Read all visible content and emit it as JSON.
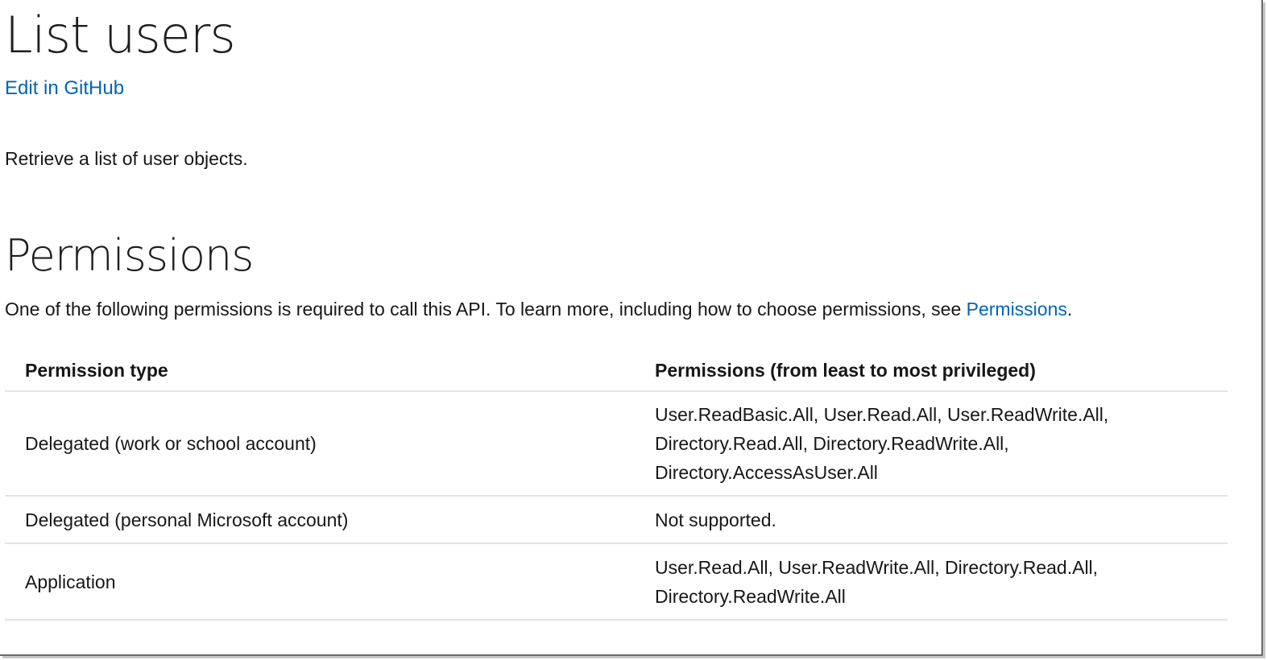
{
  "title": "List users",
  "edit_link": "Edit in GitHub",
  "description": "Retrieve a list of user objects.",
  "permissions_section": {
    "heading": "Permissions",
    "intro_text": "One of the following permissions is required to call this API. To learn more, including how to choose permissions, see ",
    "intro_link": "Permissions",
    "intro_end": ".",
    "table": {
      "headers": [
        "Permission type",
        "Permissions (from least to most privileged)"
      ],
      "rows": [
        {
          "type": "Delegated (work or school account)",
          "permissions": [
            "User.ReadBasic.All, User.Read.All, User.ReadWrite.All,",
            "Directory.Read.All, Directory.ReadWrite.All,",
            "Directory.AccessAsUser.All"
          ]
        },
        {
          "type": "Delegated (personal Microsoft account)",
          "permissions": [
            "Not supported."
          ]
        },
        {
          "type": "Application",
          "permissions": [
            "User.Read.All, User.ReadWrite.All, Directory.Read.All,",
            "Directory.ReadWrite.All"
          ]
        }
      ]
    }
  },
  "colors": {
    "link": "#0065b3",
    "text": "#171717",
    "table_border": "#e3e3e3"
  }
}
